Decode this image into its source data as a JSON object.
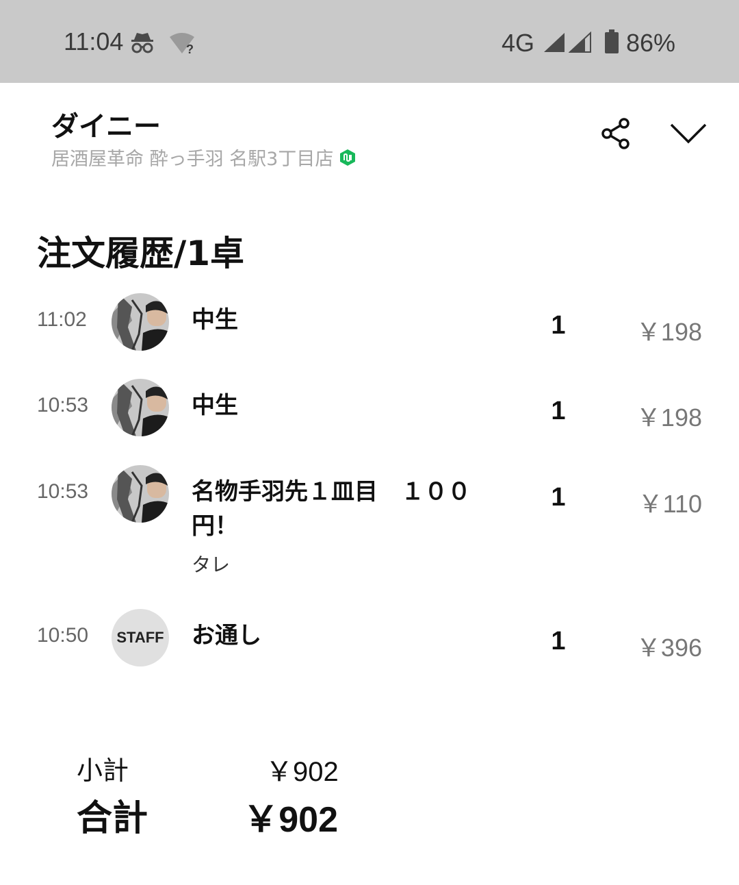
{
  "status_bar": {
    "time": "11:04",
    "network": "4G",
    "battery": "86%",
    "icons": [
      "incognito-icon",
      "wifi-unknown-icon",
      "signal-icon",
      "signal-icon",
      "battery-icon"
    ]
  },
  "header": {
    "app_name": "ダイニー",
    "store_name": "居酒屋革命 酔っ手羽 名駅3丁目店",
    "badge_color": "#18b85a",
    "icons": [
      "share-icon",
      "chevron-down-icon"
    ]
  },
  "section_title": "注文履歴/1卓",
  "orders": [
    {
      "time": "11:02",
      "avatar": "photo",
      "name": "中生",
      "option": "",
      "qty": "1",
      "price": "￥198"
    },
    {
      "time": "10:53",
      "avatar": "photo",
      "name": "中生",
      "option": "",
      "qty": "1",
      "price": "￥198"
    },
    {
      "time": "10:53",
      "avatar": "photo",
      "name": "名物手羽先１皿目　１００円！",
      "option": "タレ",
      "qty": "1",
      "price": "￥110"
    },
    {
      "time": "10:50",
      "avatar": "STAFF",
      "name": "お通し",
      "option": "",
      "qty": "1",
      "price": "￥396"
    }
  ],
  "totals": {
    "subtotal_label": "小計",
    "subtotal_value": "￥902",
    "total_label": "合計",
    "total_value": "￥902"
  }
}
